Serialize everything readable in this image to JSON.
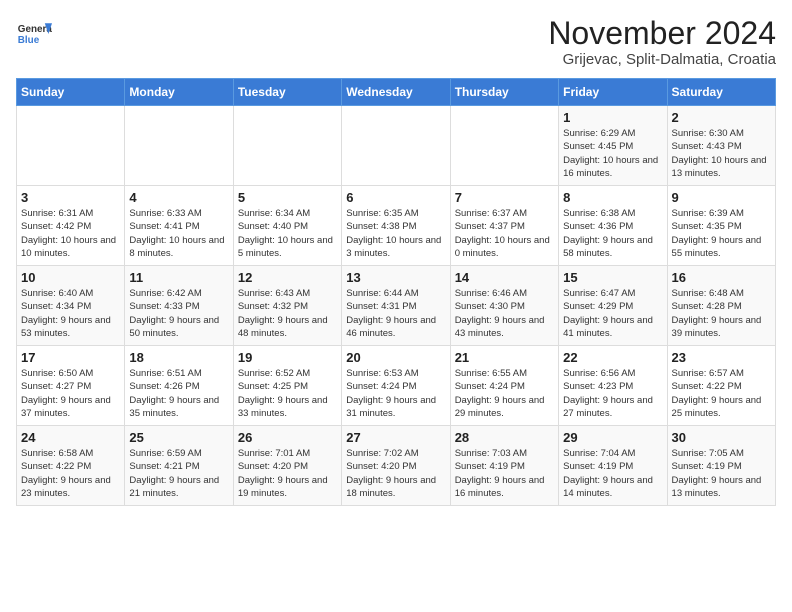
{
  "logo": {
    "general": "General",
    "blue": "Blue"
  },
  "title": "November 2024",
  "subtitle": "Grijevac, Split-Dalmatia, Croatia",
  "days_of_week": [
    "Sunday",
    "Monday",
    "Tuesday",
    "Wednesday",
    "Thursday",
    "Friday",
    "Saturday"
  ],
  "weeks": [
    [
      {
        "day": "",
        "info": ""
      },
      {
        "day": "",
        "info": ""
      },
      {
        "day": "",
        "info": ""
      },
      {
        "day": "",
        "info": ""
      },
      {
        "day": "",
        "info": ""
      },
      {
        "day": "1",
        "info": "Sunrise: 6:29 AM\nSunset: 4:45 PM\nDaylight: 10 hours and 16 minutes."
      },
      {
        "day": "2",
        "info": "Sunrise: 6:30 AM\nSunset: 4:43 PM\nDaylight: 10 hours and 13 minutes."
      }
    ],
    [
      {
        "day": "3",
        "info": "Sunrise: 6:31 AM\nSunset: 4:42 PM\nDaylight: 10 hours and 10 minutes."
      },
      {
        "day": "4",
        "info": "Sunrise: 6:33 AM\nSunset: 4:41 PM\nDaylight: 10 hours and 8 minutes."
      },
      {
        "day": "5",
        "info": "Sunrise: 6:34 AM\nSunset: 4:40 PM\nDaylight: 10 hours and 5 minutes."
      },
      {
        "day": "6",
        "info": "Sunrise: 6:35 AM\nSunset: 4:38 PM\nDaylight: 10 hours and 3 minutes."
      },
      {
        "day": "7",
        "info": "Sunrise: 6:37 AM\nSunset: 4:37 PM\nDaylight: 10 hours and 0 minutes."
      },
      {
        "day": "8",
        "info": "Sunrise: 6:38 AM\nSunset: 4:36 PM\nDaylight: 9 hours and 58 minutes."
      },
      {
        "day": "9",
        "info": "Sunrise: 6:39 AM\nSunset: 4:35 PM\nDaylight: 9 hours and 55 minutes."
      }
    ],
    [
      {
        "day": "10",
        "info": "Sunrise: 6:40 AM\nSunset: 4:34 PM\nDaylight: 9 hours and 53 minutes."
      },
      {
        "day": "11",
        "info": "Sunrise: 6:42 AM\nSunset: 4:33 PM\nDaylight: 9 hours and 50 minutes."
      },
      {
        "day": "12",
        "info": "Sunrise: 6:43 AM\nSunset: 4:32 PM\nDaylight: 9 hours and 48 minutes."
      },
      {
        "day": "13",
        "info": "Sunrise: 6:44 AM\nSunset: 4:31 PM\nDaylight: 9 hours and 46 minutes."
      },
      {
        "day": "14",
        "info": "Sunrise: 6:46 AM\nSunset: 4:30 PM\nDaylight: 9 hours and 43 minutes."
      },
      {
        "day": "15",
        "info": "Sunrise: 6:47 AM\nSunset: 4:29 PM\nDaylight: 9 hours and 41 minutes."
      },
      {
        "day": "16",
        "info": "Sunrise: 6:48 AM\nSunset: 4:28 PM\nDaylight: 9 hours and 39 minutes."
      }
    ],
    [
      {
        "day": "17",
        "info": "Sunrise: 6:50 AM\nSunset: 4:27 PM\nDaylight: 9 hours and 37 minutes."
      },
      {
        "day": "18",
        "info": "Sunrise: 6:51 AM\nSunset: 4:26 PM\nDaylight: 9 hours and 35 minutes."
      },
      {
        "day": "19",
        "info": "Sunrise: 6:52 AM\nSunset: 4:25 PM\nDaylight: 9 hours and 33 minutes."
      },
      {
        "day": "20",
        "info": "Sunrise: 6:53 AM\nSunset: 4:24 PM\nDaylight: 9 hours and 31 minutes."
      },
      {
        "day": "21",
        "info": "Sunrise: 6:55 AM\nSunset: 4:24 PM\nDaylight: 9 hours and 29 minutes."
      },
      {
        "day": "22",
        "info": "Sunrise: 6:56 AM\nSunset: 4:23 PM\nDaylight: 9 hours and 27 minutes."
      },
      {
        "day": "23",
        "info": "Sunrise: 6:57 AM\nSunset: 4:22 PM\nDaylight: 9 hours and 25 minutes."
      }
    ],
    [
      {
        "day": "24",
        "info": "Sunrise: 6:58 AM\nSunset: 4:22 PM\nDaylight: 9 hours and 23 minutes."
      },
      {
        "day": "25",
        "info": "Sunrise: 6:59 AM\nSunset: 4:21 PM\nDaylight: 9 hours and 21 minutes."
      },
      {
        "day": "26",
        "info": "Sunrise: 7:01 AM\nSunset: 4:20 PM\nDaylight: 9 hours and 19 minutes."
      },
      {
        "day": "27",
        "info": "Sunrise: 7:02 AM\nSunset: 4:20 PM\nDaylight: 9 hours and 18 minutes."
      },
      {
        "day": "28",
        "info": "Sunrise: 7:03 AM\nSunset: 4:19 PM\nDaylight: 9 hours and 16 minutes."
      },
      {
        "day": "29",
        "info": "Sunrise: 7:04 AM\nSunset: 4:19 PM\nDaylight: 9 hours and 14 minutes."
      },
      {
        "day": "30",
        "info": "Sunrise: 7:05 AM\nSunset: 4:19 PM\nDaylight: 9 hours and 13 minutes."
      }
    ]
  ]
}
